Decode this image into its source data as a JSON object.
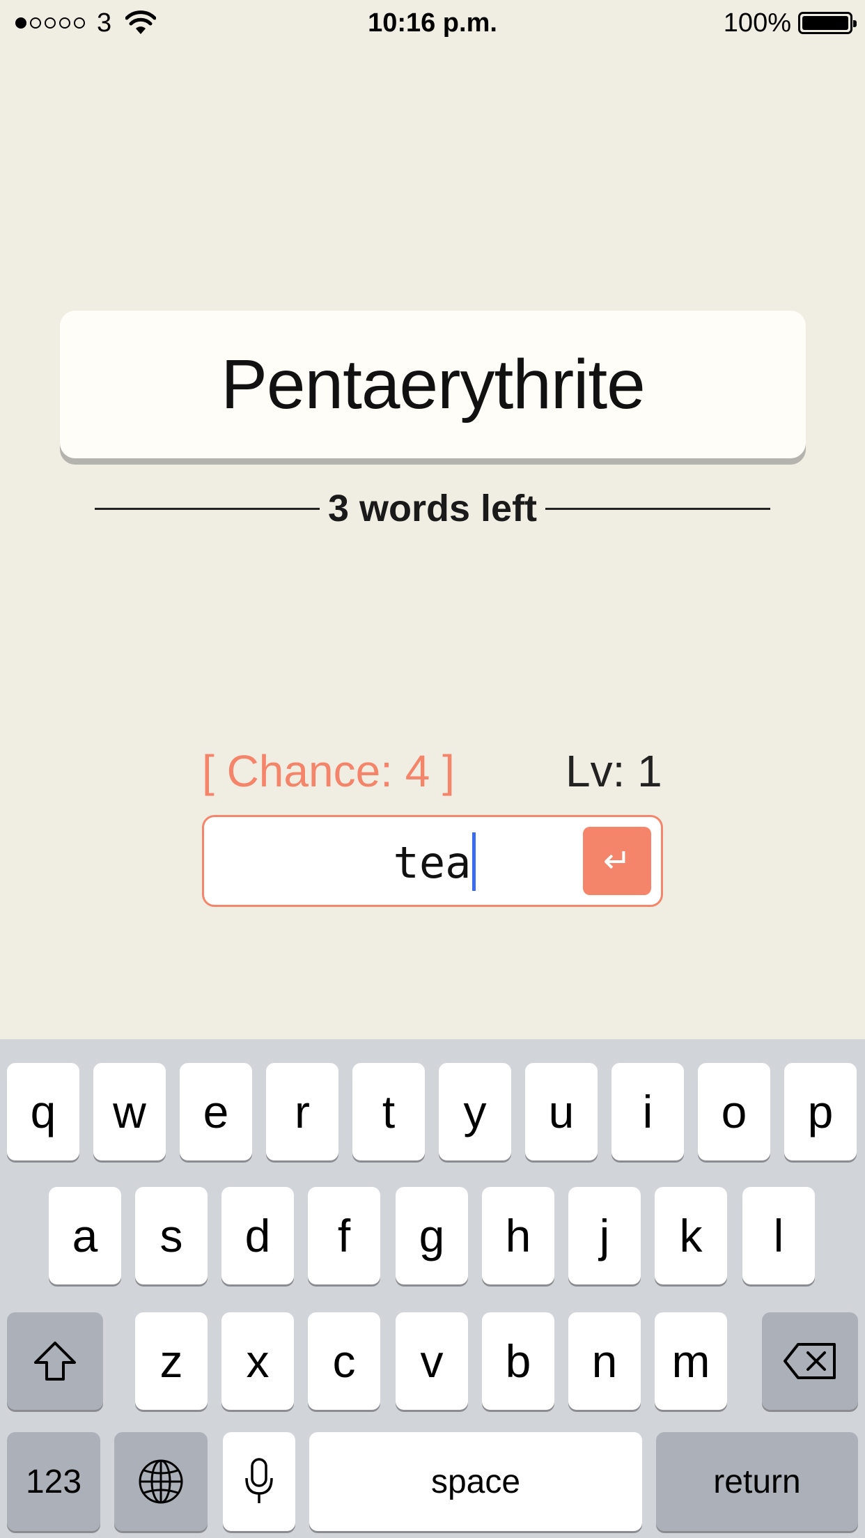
{
  "status_bar": {
    "signal_dots": [
      true,
      false,
      false,
      false,
      false
    ],
    "carrier": "3",
    "time": "10:16 p.m.",
    "battery": "100%",
    "wifi_icon": "wifi-icon",
    "battery_icon": "battery-icon"
  },
  "game": {
    "word": "Pentaerythrite",
    "words_left": "3 words left",
    "chance": "[ Chance: 4 ]",
    "level": "Lv: 1",
    "input_value": "tea",
    "enter_icon": "return-arrow-icon",
    "enter_glyph": "↵"
  },
  "keyboard": {
    "row1": [
      "q",
      "w",
      "e",
      "r",
      "t",
      "y",
      "u",
      "i",
      "o",
      "p"
    ],
    "row2": [
      "a",
      "s",
      "d",
      "f",
      "g",
      "h",
      "j",
      "k",
      "l"
    ],
    "row3": [
      "z",
      "x",
      "c",
      "v",
      "b",
      "n",
      "m"
    ],
    "numbers_key": "123",
    "space_key": "space",
    "return_key": "return",
    "shift_icon": "shift-icon",
    "delete_icon": "backspace-icon",
    "globe_icon": "globe-icon",
    "mic_icon": "microphone-icon"
  },
  "colors": {
    "background": "#f0ede2",
    "accent": "#f4856a",
    "caret": "#3b6cf0"
  }
}
